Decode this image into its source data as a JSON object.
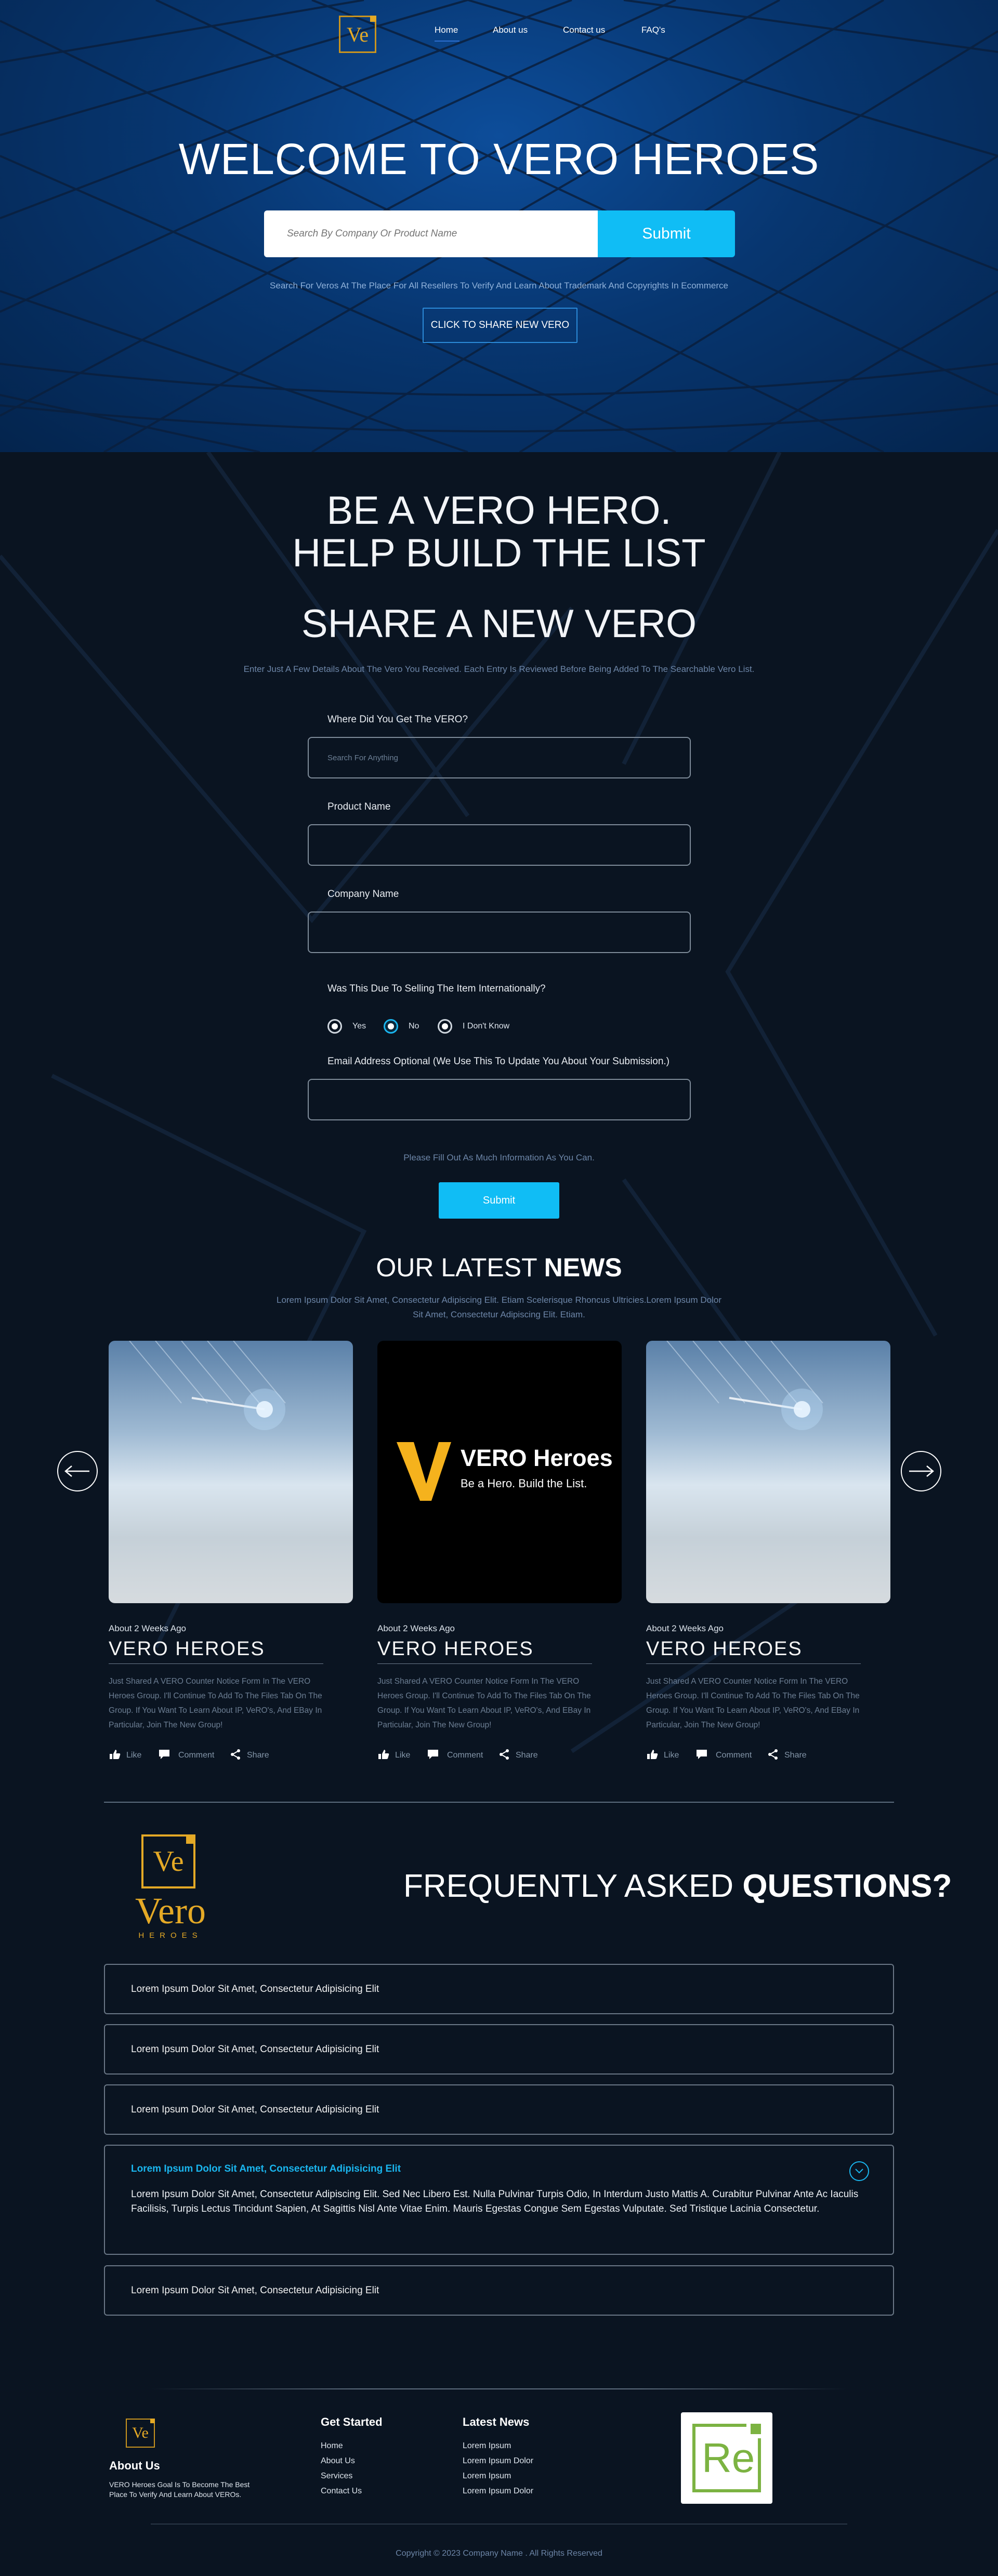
{
  "nav": {
    "logo_text": "Ve",
    "links": [
      "Home",
      "About us",
      "Contact us",
      "FAQ's"
    ]
  },
  "hero": {
    "title": "WELCOME TO VERO HEROES",
    "search_placeholder": "Search By Company Or Product Name",
    "search_button": "Submit",
    "subtitle": "Search For Veros At The Place For All Resellers To Verify And Learn About Trademark And Copyrights In Ecommerce",
    "share_button": "CLICK TO SHARE NEW VERO"
  },
  "form": {
    "heading_line1": "BE A VERO HERO.",
    "heading_line2": "HELP BUILD THE LIST",
    "heading2": "SHARE A NEW VERO",
    "description": "Enter Just A Few Details About The Vero You Received. Each Entry Is Reviewed Before Being Added To The Searchable Vero List.",
    "where_label": "Where Did You Get The VERO?",
    "where_placeholder": "Search For Anything",
    "product_label": "Product Name",
    "company_label": "Company Name",
    "intl_label": "Was This Due To Selling The Item Internationally?",
    "radio_options": [
      "Yes",
      "No",
      "I Don't Know"
    ],
    "email_label": "Email Address Optional (We Use This To Update You About Your Submission.)",
    "note": "Please Fill Out As Much Information As You Can.",
    "submit": "Submit"
  },
  "news": {
    "heading_light": "OUR LATEST",
    "heading_bold": "NEWS",
    "intro": "Lorem Ipsum Dolor Sit Amet, Consectetur Adipiscing Elit. Etiam Scelerisque Rhoncus Ultricies.Lorem Ipsum Dolor Sit Amet, Consectetur Adipiscing Elit. Etiam.",
    "cards": [
      {
        "meta": "About 2 Weeks Ago",
        "title": "VERO HEROES",
        "text": "Just Shared A VERO Counter Notice Form In The VERO Heroes Group. I'll Continue To Add To The Files Tab On The Group. If You Want To Learn About IP, VeRO's, And EBay In Particular, Join The New Group!",
        "like": "Like",
        "comment": "Comment",
        "share": "Share"
      },
      {
        "meta": "About 2 Weeks Ago",
        "title": "VERO HEROES",
        "text": "Just Shared A VERO Counter Notice Form In The VERO Heroes Group. I'll Continue To Add To The Files Tab On The Group. If You Want To Learn About IP, VeRO's, And EBay In Particular, Join The New Group!",
        "like": "Like",
        "comment": "Comment",
        "share": "Share",
        "image_logo_text": "VERO Heroes",
        "image_tagline": "Be a Hero. Build the List."
      },
      {
        "meta": "About 2 Weeks Ago",
        "title": "VERO HEROES",
        "text": "Just Shared A VERO Counter Notice Form In The VERO Heroes Group. I'll Continue To Add To The Files Tab On The Group. If You Want To Learn About IP, VeRO's, And EBay In Particular, Join The New Group!",
        "like": "Like",
        "comment": "Comment",
        "share": "Share"
      }
    ]
  },
  "faq": {
    "logo_mark": "Ve",
    "logo_word": "Vero",
    "logo_sub": "HEROES",
    "heading_light": "FREQUENTLY ASKED",
    "heading_bold": "QUESTIONS?",
    "items": [
      "Lorem Ipsum Dolor Sit Amet, Consectetur Adipisicing Elit",
      "Lorem Ipsum Dolor Sit Amet, Consectetur Adipisicing Elit",
      "Lorem Ipsum Dolor Sit Amet, Consectetur Adipisicing Elit",
      "Lorem Ipsum Dolor Sit Amet, Consectetur Adipisicing Elit",
      "Lorem Ipsum Dolor Sit Amet, Consectetur Adipisicing Elit"
    ],
    "open_answer": "Lorem Ipsum Dolor Sit Amet, Consectetur Adipiscing Elit. Sed Nec Libero Est. Nulla Pulvinar Turpis Odio, In Interdum Justo Mattis A. Curabitur Pulvinar Ante Ac Iaculis Facilisis, Turpis Lectus Tincidunt Sapien, At Sagittis Nisl Ante Vitae Enim. Mauris Egestas Congue Sem Egestas Vulputate. Sed Tristique Lacinia Consectetur."
  },
  "footer": {
    "logo_text": "Ve",
    "about_heading": "About Us",
    "about_text": "VERO Heroes Goal Is To Become The Best Place To Verify And Learn About VEROs.",
    "get_started_heading": "Get Started",
    "get_started_links": [
      "Home",
      "About Us",
      "Services",
      "Contact Us"
    ],
    "news_heading": "Latest News",
    "news_links": [
      "Lorem Ipsum",
      "Lorem Ipsum Dolor",
      "Lorem Ipsum",
      "Lorem Ipsum Dolor"
    ],
    "partner_logo_text": "Re",
    "copyright": "Copyright © 2023 Company Name . All Rights Reserved"
  },
  "colors": {
    "accent": "#10bdf5",
    "gold": "#e4a926",
    "background": "#0a1421",
    "hero": "#073670"
  }
}
